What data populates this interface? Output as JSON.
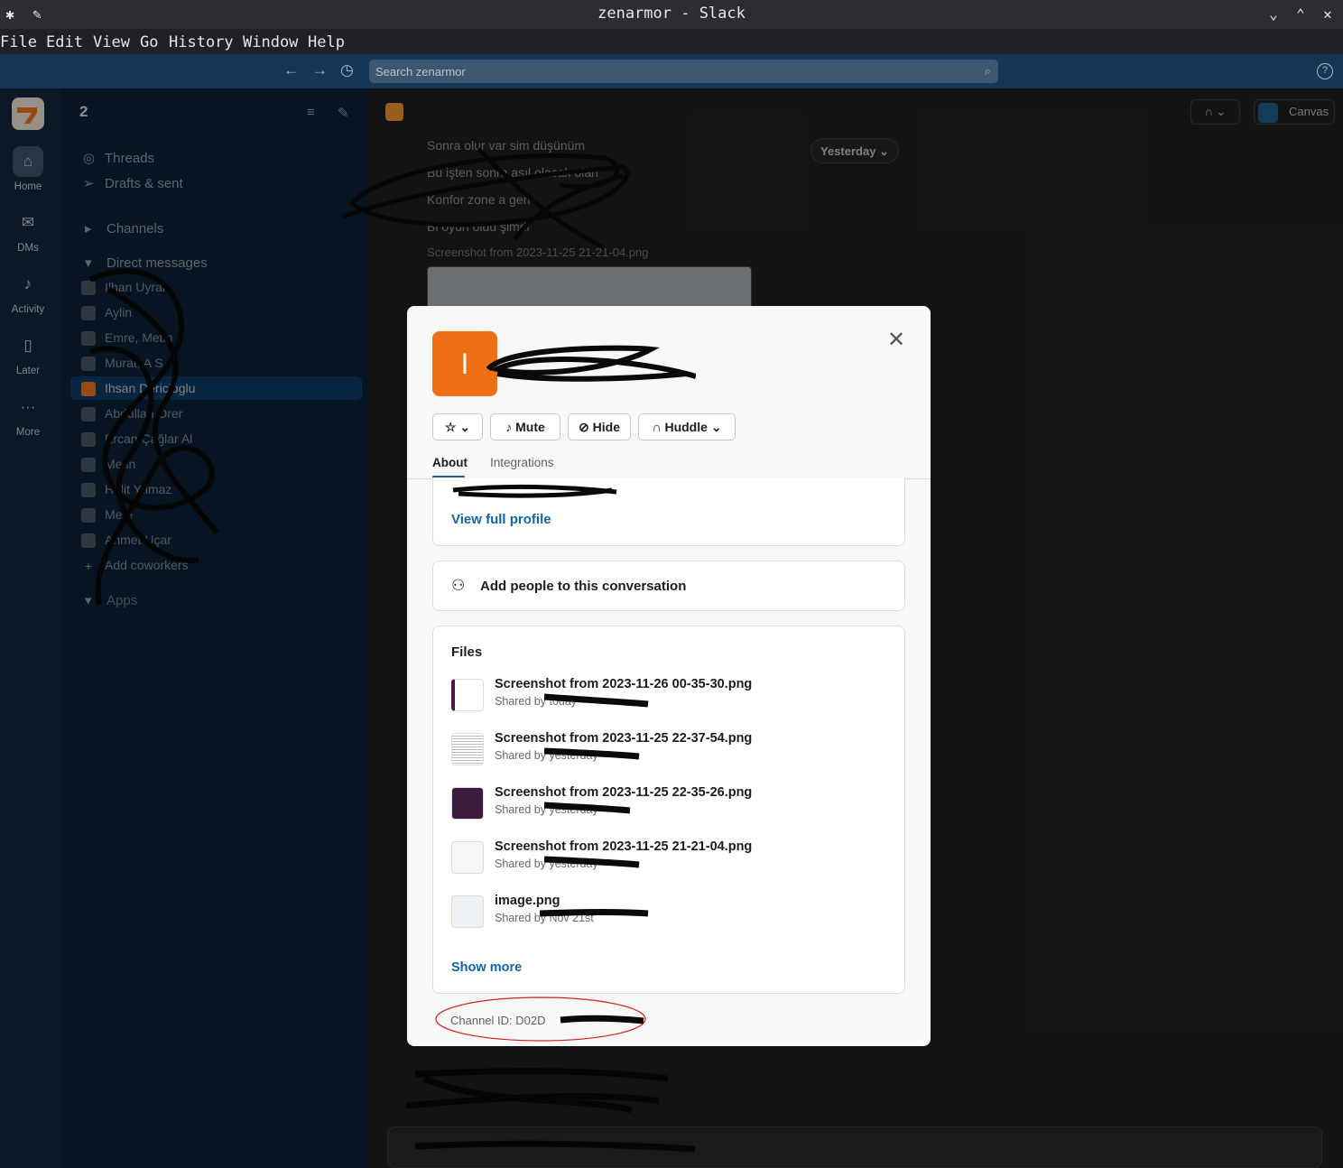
{
  "window": {
    "title": "zenarmor - Slack"
  },
  "menu": [
    "File",
    "Edit",
    "View",
    "Go",
    "History",
    "Window",
    "Help"
  ],
  "search": {
    "placeholder": "Search zenarmor"
  },
  "rail": {
    "items": [
      {
        "label": "Home",
        "icon": "home-icon"
      },
      {
        "label": "DMs",
        "icon": "dms-icon"
      },
      {
        "label": "Activity",
        "icon": "bell-icon"
      },
      {
        "label": "Later",
        "icon": "bookmark-icon"
      },
      {
        "label": "More",
        "icon": "more-icon"
      }
    ]
  },
  "sidebar": {
    "threads": "Threads",
    "drafts": "Drafts & sent",
    "channels": "Channels",
    "direct_messages": "Direct messages",
    "dm_items": [
      "Ilhan Uyrak",
      "Aylin",
      "Emre, Metin",
      "Murat, A S",
      "Ihsan Dericioglu",
      "Abdullah Örer",
      "Ercan Çağlar Al",
      "Metin",
      "Halit Yılmaz",
      "Mete",
      "Ahmet Uçar",
      "Add coworkers"
    ],
    "apps": "Apps"
  },
  "main": {
    "yesterday": "Yesterday",
    "messages": [
      "Sonra olur var sim düşünüm",
      "Bu işten sonra asıl olacak olan",
      "Konfor zone a geri",
      "Bi oyun oldu şimdi"
    ],
    "attachment_name": "Screenshot from 2023-11-25 21-21-04.png",
    "canvas_label": "Canvas"
  },
  "modal": {
    "avatar_letter": "I",
    "buttons": {
      "mute": "Mute",
      "hide": "Hide",
      "huddle": "Huddle"
    },
    "tabs": {
      "about": "About",
      "integrations": "Integrations"
    },
    "view_full_profile": "View full profile",
    "add_people": "Add people to this conversation",
    "files_title": "Files",
    "files": [
      {
        "name": "Screenshot from 2023-11-26 00-35-30.png",
        "meta": "Shared by today"
      },
      {
        "name": "Screenshot from 2023-11-25 22-37-54.png",
        "meta": "Shared by yesterday"
      },
      {
        "name": "Screenshot from 2023-11-25 22-35-26.png",
        "meta": "Shared by yesterday"
      },
      {
        "name": "Screenshot from 2023-11-25 21-21-04.png",
        "meta": "Shared by yesterday"
      },
      {
        "name": "image.png",
        "meta": "Shared by Nov 21st"
      }
    ],
    "show_more": "Show more",
    "channel_id": "Channel ID: D02D"
  }
}
